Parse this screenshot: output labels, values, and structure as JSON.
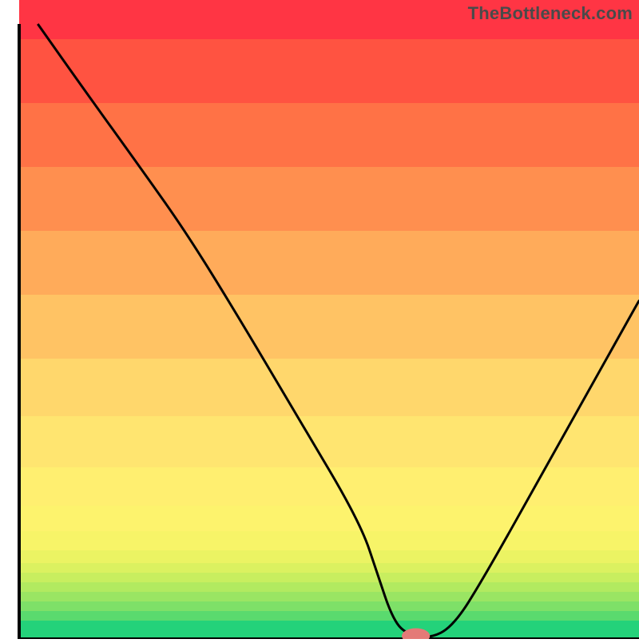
{
  "watermark": "TheBottleneck.com",
  "chart_data": {
    "type": "line",
    "title": "",
    "xlabel": "",
    "ylabel": "",
    "xlim": [
      0,
      100
    ],
    "ylim": [
      0,
      100
    ],
    "series": [
      {
        "name": "curve",
        "x": [
          3,
          10,
          20,
          27,
          35,
          45,
          55,
          58,
          60,
          62,
          66,
          70,
          75,
          85,
          95,
          100
        ],
        "y": [
          100,
          90,
          76,
          66,
          53,
          36,
          19,
          10,
          4,
          1,
          0,
          2,
          10,
          28,
          46,
          55
        ]
      }
    ],
    "marker": {
      "x": 64,
      "y": 0.5,
      "rx": 2.2,
      "ry": 1.2,
      "color": "#e47a77"
    },
    "gradient_bands": [
      {
        "y0": 100,
        "y1": 97,
        "color": "#24d27a"
      },
      {
        "y0": 97,
        "y1": 95.5,
        "color": "#5ada6e"
      },
      {
        "y0": 95.5,
        "y1": 94,
        "color": "#7ee068"
      },
      {
        "y0": 94,
        "y1": 92.5,
        "color": "#9ae563"
      },
      {
        "y0": 92.5,
        "y1": 91,
        "color": "#b2ea60"
      },
      {
        "y0": 91,
        "y1": 89.5,
        "color": "#c8ee5f"
      },
      {
        "y0": 89.5,
        "y1": 88,
        "color": "#dbf160"
      },
      {
        "y0": 88,
        "y1": 86,
        "color": "#ebf363"
      },
      {
        "y0": 86,
        "y1": 83,
        "color": "#f7f468"
      },
      {
        "y0": 83,
        "y1": 79,
        "color": "#fdf36d"
      },
      {
        "y0": 79,
        "y1": 73,
        "color": "#ffef70"
      },
      {
        "y0": 73,
        "y1": 65,
        "color": "#ffe570"
      },
      {
        "y0": 65,
        "y1": 56,
        "color": "#ffd76c"
      },
      {
        "y0": 56,
        "y1": 46,
        "color": "#ffc364"
      },
      {
        "y0": 46,
        "y1": 36,
        "color": "#ffab5a"
      },
      {
        "y0": 36,
        "y1": 26,
        "color": "#ff8f4f"
      },
      {
        "y0": 26,
        "y1": 16,
        "color": "#ff7246"
      },
      {
        "y0": 16,
        "y1": 6,
        "color": "#ff5341"
      },
      {
        "y0": 6,
        "y1": 0,
        "color": "#ff3544"
      }
    ],
    "axes": {
      "left_x": 3,
      "bottom_y": 100
    }
  }
}
